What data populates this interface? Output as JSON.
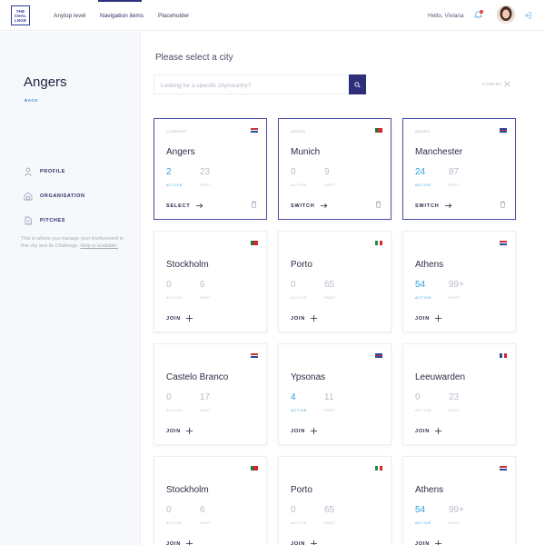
{
  "header": {
    "logo_lines": [
      "THE",
      "CHAL",
      "LNGE"
    ],
    "nav": [
      {
        "label": "Anytop level"
      },
      {
        "label": "Navigation items"
      },
      {
        "label": "Placeholder"
      }
    ],
    "greeting": "Hello, Viviana"
  },
  "sidebar": {
    "city": "Angers",
    "back": "BACK",
    "items": [
      {
        "label": "PROFILE",
        "icon": "user-icon"
      },
      {
        "label": "ORGANISATION",
        "icon": "organisation-icon"
      },
      {
        "label": "PITCHES",
        "icon": "pitches-icon"
      }
    ],
    "note": "This is where you manage your involvement in this city and its Challenge.",
    "help": "Help is available."
  },
  "main": {
    "title": "Please select a city",
    "search_placeholder": "Looking for a specific city/country?",
    "cancel": "CANCEL"
  },
  "cards": [
    {
      "status": "CURRENT",
      "name": "Angers",
      "active": "2",
      "past": "23",
      "active_label": "ACTIVE",
      "past_label": "PAST",
      "action": "SELECT",
      "flag": "nl",
      "selected": true,
      "highlight": true,
      "trash": true
    },
    {
      "status": "ADDED",
      "name": "Munich",
      "active": "0",
      "past": "9",
      "active_label": "ACTIVE",
      "past_label": "PAST",
      "action": "SWITCH",
      "flag": "pt",
      "selected": true,
      "highlight": false,
      "trash": true
    },
    {
      "status": "ADDED",
      "name": "Manchester",
      "active": "24",
      "past": "87",
      "active_label": "ACTIVE",
      "past_label": "PAST",
      "action": "SWITCH",
      "flag": "gb",
      "selected": true,
      "highlight": true,
      "trash": true
    },
    {
      "status": "",
      "name": "Stockholm",
      "active": "0",
      "past": "6",
      "active_label": "ACTIVE",
      "past_label": "PAST",
      "action": "JOIN",
      "flag": "pt",
      "selected": false,
      "highlight": false,
      "trash": false
    },
    {
      "status": "",
      "name": "Porto",
      "active": "0",
      "past": "65",
      "active_label": "ACTIVE",
      "past_label": "PAST",
      "action": "JOIN",
      "flag": "it",
      "selected": false,
      "highlight": false,
      "trash": false
    },
    {
      "status": "",
      "name": "Athens",
      "active": "54",
      "past": "99+",
      "active_label": "ACTIVE",
      "past_label": "PAST",
      "action": "JOIN",
      "flag": "nl",
      "selected": false,
      "highlight": true,
      "trash": false
    },
    {
      "status": "",
      "name": "Castelo Branco",
      "active": "0",
      "past": "17",
      "active_label": "ACTIVE",
      "past_label": "PAST",
      "action": "JOIN",
      "flag": "nl",
      "selected": false,
      "highlight": false,
      "trash": false
    },
    {
      "status": "",
      "name": "Ypsonas",
      "active": "4",
      "past": "11",
      "active_label": "ACTIVE",
      "past_label": "PAST",
      "action": "JOIN",
      "flag": "gb",
      "selected": false,
      "highlight": true,
      "trash": false
    },
    {
      "status": "",
      "name": "Leeuwarden",
      "active": "0",
      "past": "23",
      "active_label": "ACTIVE",
      "past_label": "PAST",
      "action": "JOIN",
      "flag": "fr",
      "selected": false,
      "highlight": false,
      "trash": false
    },
    {
      "status": "",
      "name": "Stockholm",
      "active": "0",
      "past": "6",
      "active_label": "ACTIVE",
      "past_label": "PAST",
      "action": "JOIN",
      "flag": "pt",
      "selected": false,
      "highlight": false,
      "trash": false
    },
    {
      "status": "",
      "name": "Porto",
      "active": "0",
      "past": "65",
      "active_label": "ACTIVE",
      "past_label": "PAST",
      "action": "JOIN",
      "flag": "it",
      "selected": false,
      "highlight": false,
      "trash": false
    },
    {
      "status": "",
      "name": "Athens",
      "active": "54",
      "past": "99+",
      "active_label": "ACTIVE",
      "past_label": "PAST",
      "action": "JOIN",
      "flag": "nl",
      "selected": false,
      "highlight": true,
      "trash": false
    }
  ],
  "colors": {
    "primary": "#2d2f7a",
    "accent": "#2f9fe0",
    "muted": "#b9bdca"
  }
}
